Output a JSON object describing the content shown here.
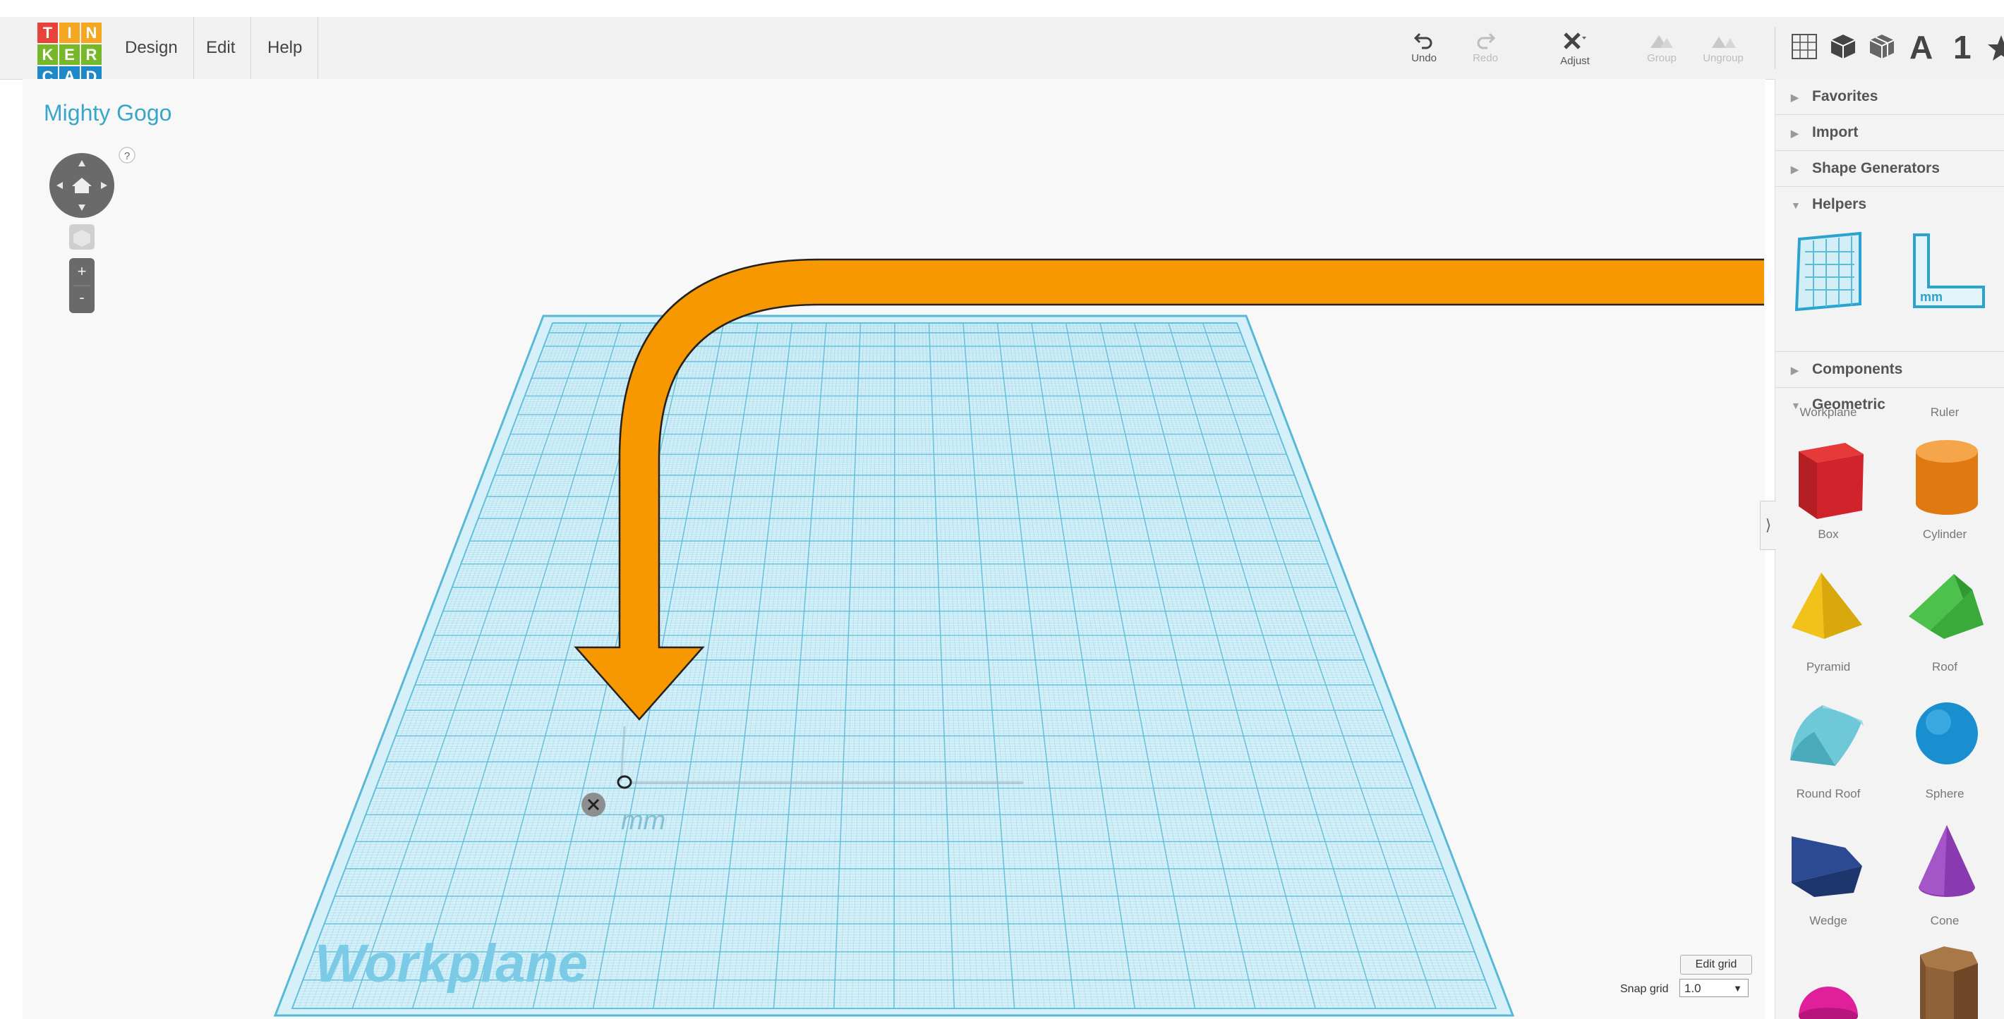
{
  "app": {
    "logo_letters": [
      "T",
      "I",
      "N",
      "K",
      "E",
      "R",
      "C",
      "A",
      "D"
    ],
    "menu": [
      "Design",
      "Edit",
      "Help"
    ],
    "project_title": "Mighty Gogo"
  },
  "toolbar": {
    "undo": "Undo",
    "redo": "Redo",
    "adjust": "Adjust",
    "group": "Group",
    "ungroup": "Ungroup",
    "view_text_a": "A",
    "view_text_1": "1"
  },
  "nav": {
    "help": "?",
    "zoom_in": "+",
    "zoom_out": "-"
  },
  "workplane": {
    "label": "Workplane",
    "unit": "mm"
  },
  "panel": {
    "sections": {
      "favorites": "Favorites",
      "import": "Import",
      "shape_generators": "Shape Generators",
      "helpers": "Helpers",
      "components": "Components",
      "geometric": "Geometric"
    },
    "helpers": [
      "Workplane",
      "Ruler"
    ],
    "ruler_icon_text": "mm",
    "geometric": [
      "Box",
      "Cylinder",
      "Pyramid",
      "Roof",
      "Round Roof",
      "Sphere",
      "Wedge",
      "Cone"
    ]
  },
  "grid": {
    "edit_grid": "Edit grid",
    "snap_label": "Snap grid",
    "snap_value": "1.0"
  },
  "colors": {
    "accent_blue": "#39a5c8",
    "arrow_orange": "#f79800",
    "grid_line": "#5bbcd8"
  }
}
